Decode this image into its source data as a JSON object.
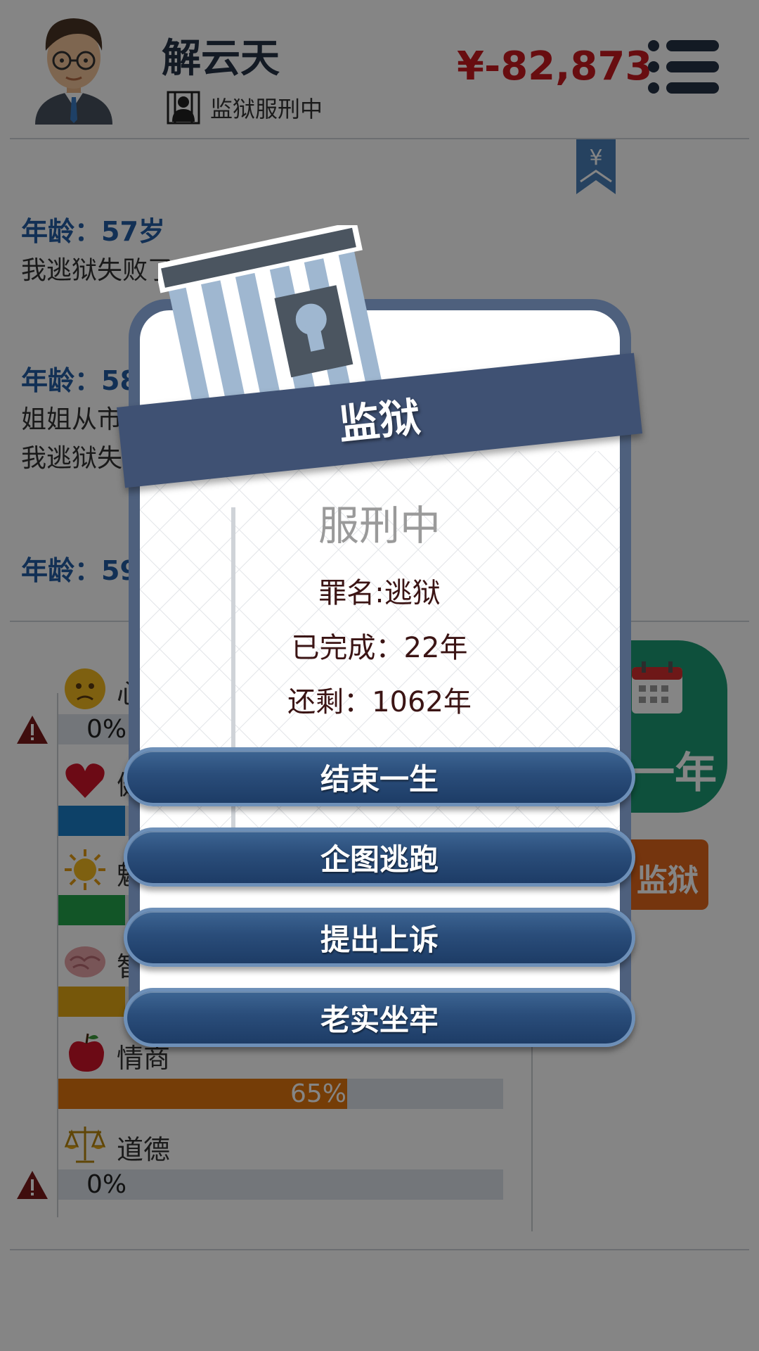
{
  "header": {
    "name": "解云天",
    "status": "监狱服刑中",
    "money": "¥-82,873"
  },
  "log": [
    {
      "age": "年龄：57岁",
      "lines": [
        "我逃狱失败了，入狱    了"
      ]
    },
    {
      "age": "年龄：58",
      "lines": [
        "姐姐从市",
        "我逃狱失"
      ]
    },
    {
      "age": "年龄：59",
      "lines": []
    }
  ],
  "bookmark_symbol": "¥",
  "stats": [
    {
      "label": "心",
      "value": "0%",
      "percent": 0,
      "color": "#1a7ec8",
      "icon": "sad-face-icon",
      "warning": true
    },
    {
      "label": "健",
      "value": "",
      "percent": 15,
      "color": "#1a7ec8",
      "icon": "heart-icon",
      "warning": false
    },
    {
      "label": "魅",
      "value": "",
      "percent": 15,
      "color": "#24a34b",
      "icon": "sun-icon",
      "warning": false
    },
    {
      "label": "智",
      "value": "",
      "percent": 15,
      "color": "#e3a815",
      "icon": "brain-icon",
      "warning": false
    },
    {
      "label": "情商",
      "value": "65%",
      "percent": 65,
      "color": "#e0750f",
      "icon": "apple-icon",
      "warning": false
    },
    {
      "label": "道德",
      "value": "0%",
      "percent": 0,
      "color": "#1a7ec8",
      "icon": "scale-icon",
      "warning": true
    }
  ],
  "side_buttons": {
    "age_label": "一年",
    "prison_label": "监狱"
  },
  "dialog": {
    "title": "监狱",
    "status": "服刑中",
    "crime": "罪名:逃狱",
    "completed": "已完成：22年",
    "remaining": "还剩：1062年",
    "buttons": [
      "结束一生",
      "企图逃跑",
      "提出上诉",
      "老实坐牢"
    ]
  },
  "colors": {
    "money": "#c8191f",
    "age_text": "#235da3",
    "dialog_button": "#2a4d7a",
    "ribbon": "#3f5173"
  }
}
